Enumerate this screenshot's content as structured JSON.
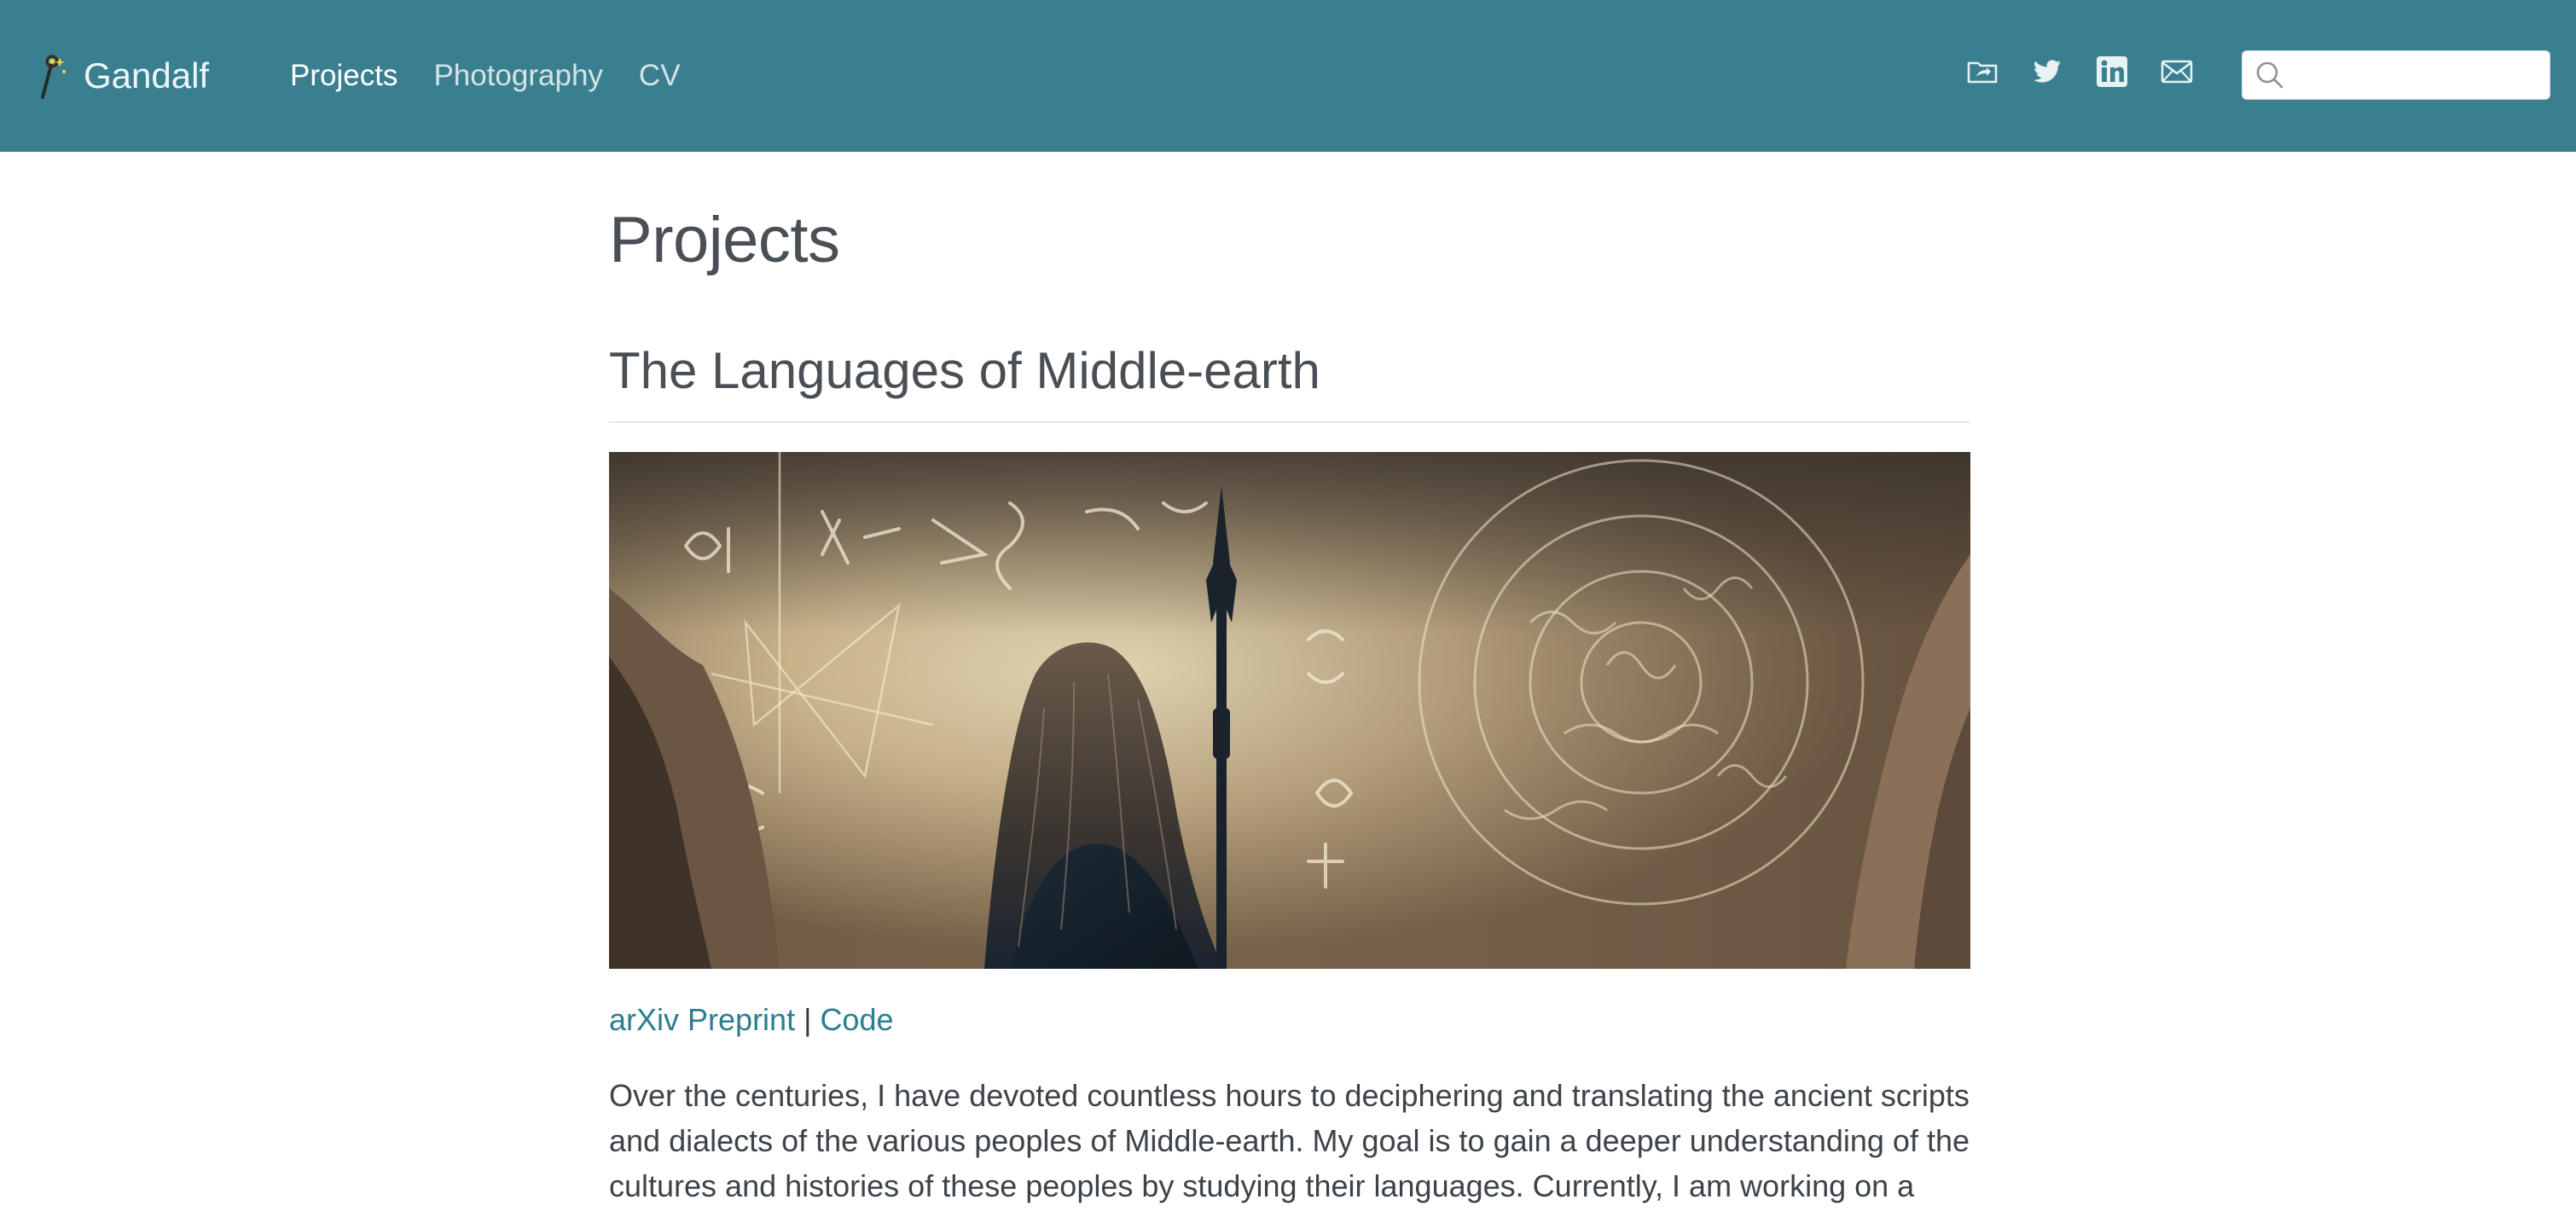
{
  "navbar": {
    "brand": "Gandalf",
    "links": [
      {
        "label": "Projects",
        "active": true
      },
      {
        "label": "Photography",
        "active": false
      },
      {
        "label": "CV",
        "active": false
      }
    ],
    "social_icons": [
      "folder-share-icon",
      "twitter-icon",
      "linkedin-icon",
      "email-icon"
    ],
    "search": {
      "placeholder": "",
      "value": ""
    }
  },
  "main": {
    "page_title": "Projects",
    "section_title": "The Languages of Middle-earth",
    "hero_image_icon": "wizard-runes-image",
    "link_arxiv": "arXiv Preprint",
    "link_separator": " | ",
    "link_code": "Code",
    "body_line_1": "Over the centuries, I have devoted countless hours to deciphering and translating the ancient scripts",
    "body_line_2": "and dialects of the various peoples of Middle-earth. My goal is to gain a deeper understanding of the",
    "body_line_3": "cultures and histories of these peoples by studying their languages. Currently, I am working on a"
  },
  "colors": {
    "navbar_bg": "#3a7f8f",
    "link": "#2b7d8f",
    "text": "#3d4349"
  }
}
